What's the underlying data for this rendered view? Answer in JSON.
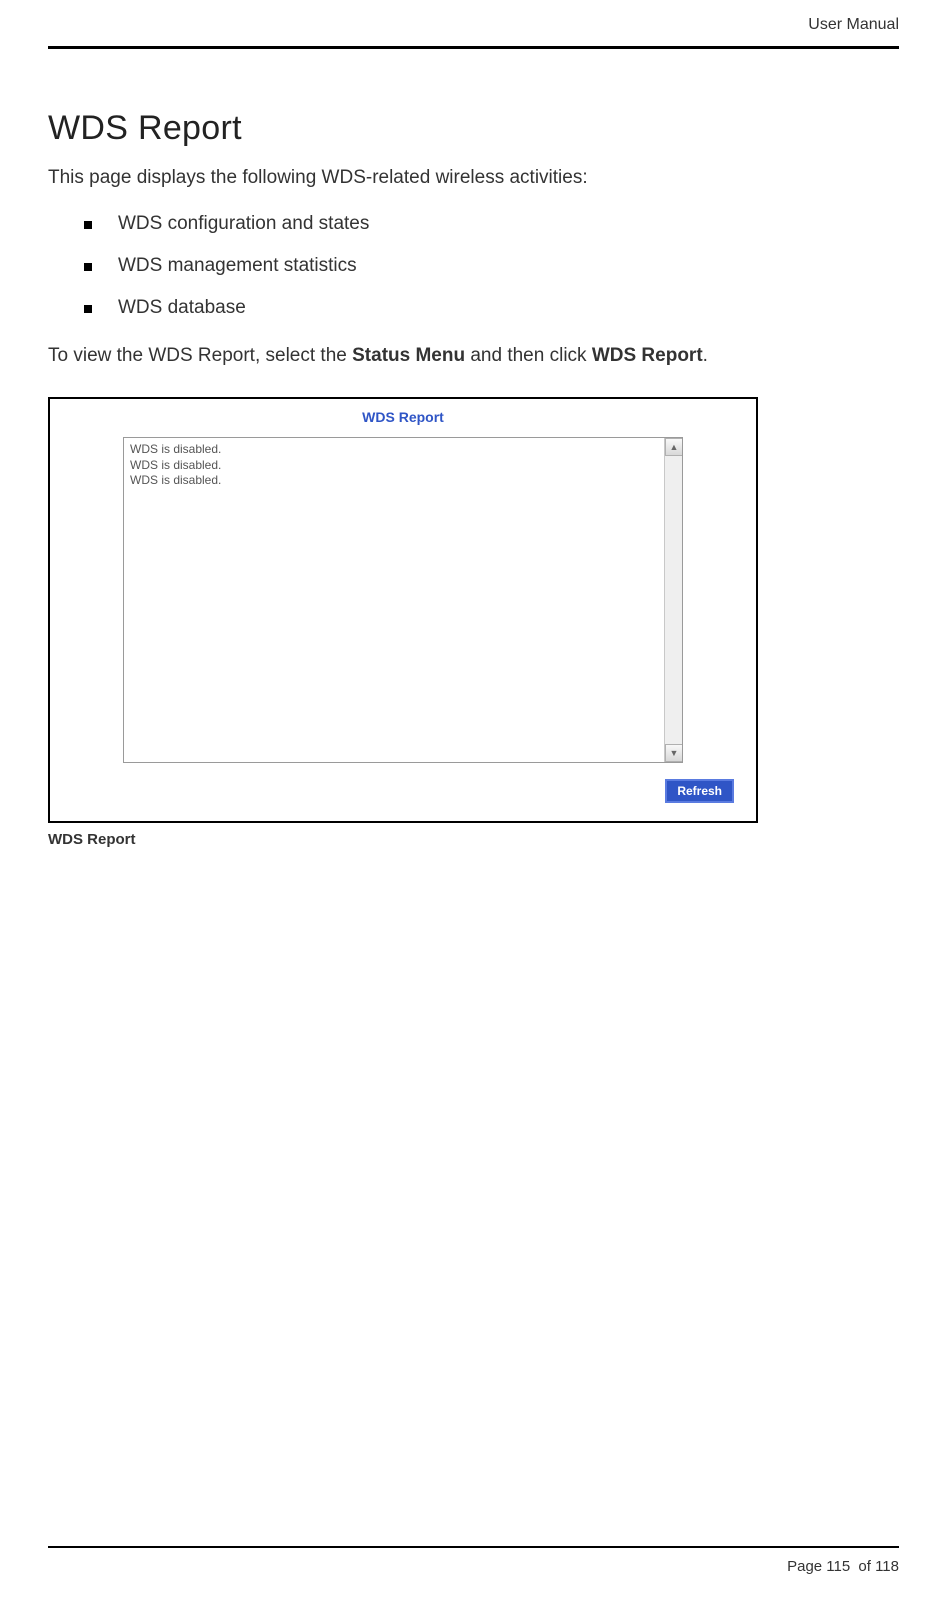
{
  "header": {
    "doc_type": "User Manual"
  },
  "section": {
    "title": "WDS Report",
    "intro": "This page displays the following WDS-related wireless activities:",
    "bullets": [
      "WDS configuration and states",
      "WDS management statistics",
      "WDS database"
    ],
    "instruction_pre": "To view the WDS Report, select the ",
    "instruction_bold1": "Status Menu",
    "instruction_mid": " and then click ",
    "instruction_bold2": "WDS Report",
    "instruction_post": "."
  },
  "screenshot": {
    "panel_title": "WDS Report",
    "lines": [
      "WDS is disabled.",
      "WDS is disabled.",
      "WDS is disabled."
    ],
    "refresh_label": "Refresh",
    "caption": "WDS Report"
  },
  "footer": {
    "prefix": "Page ",
    "current": "115",
    "sep": " of ",
    "total": "118"
  }
}
